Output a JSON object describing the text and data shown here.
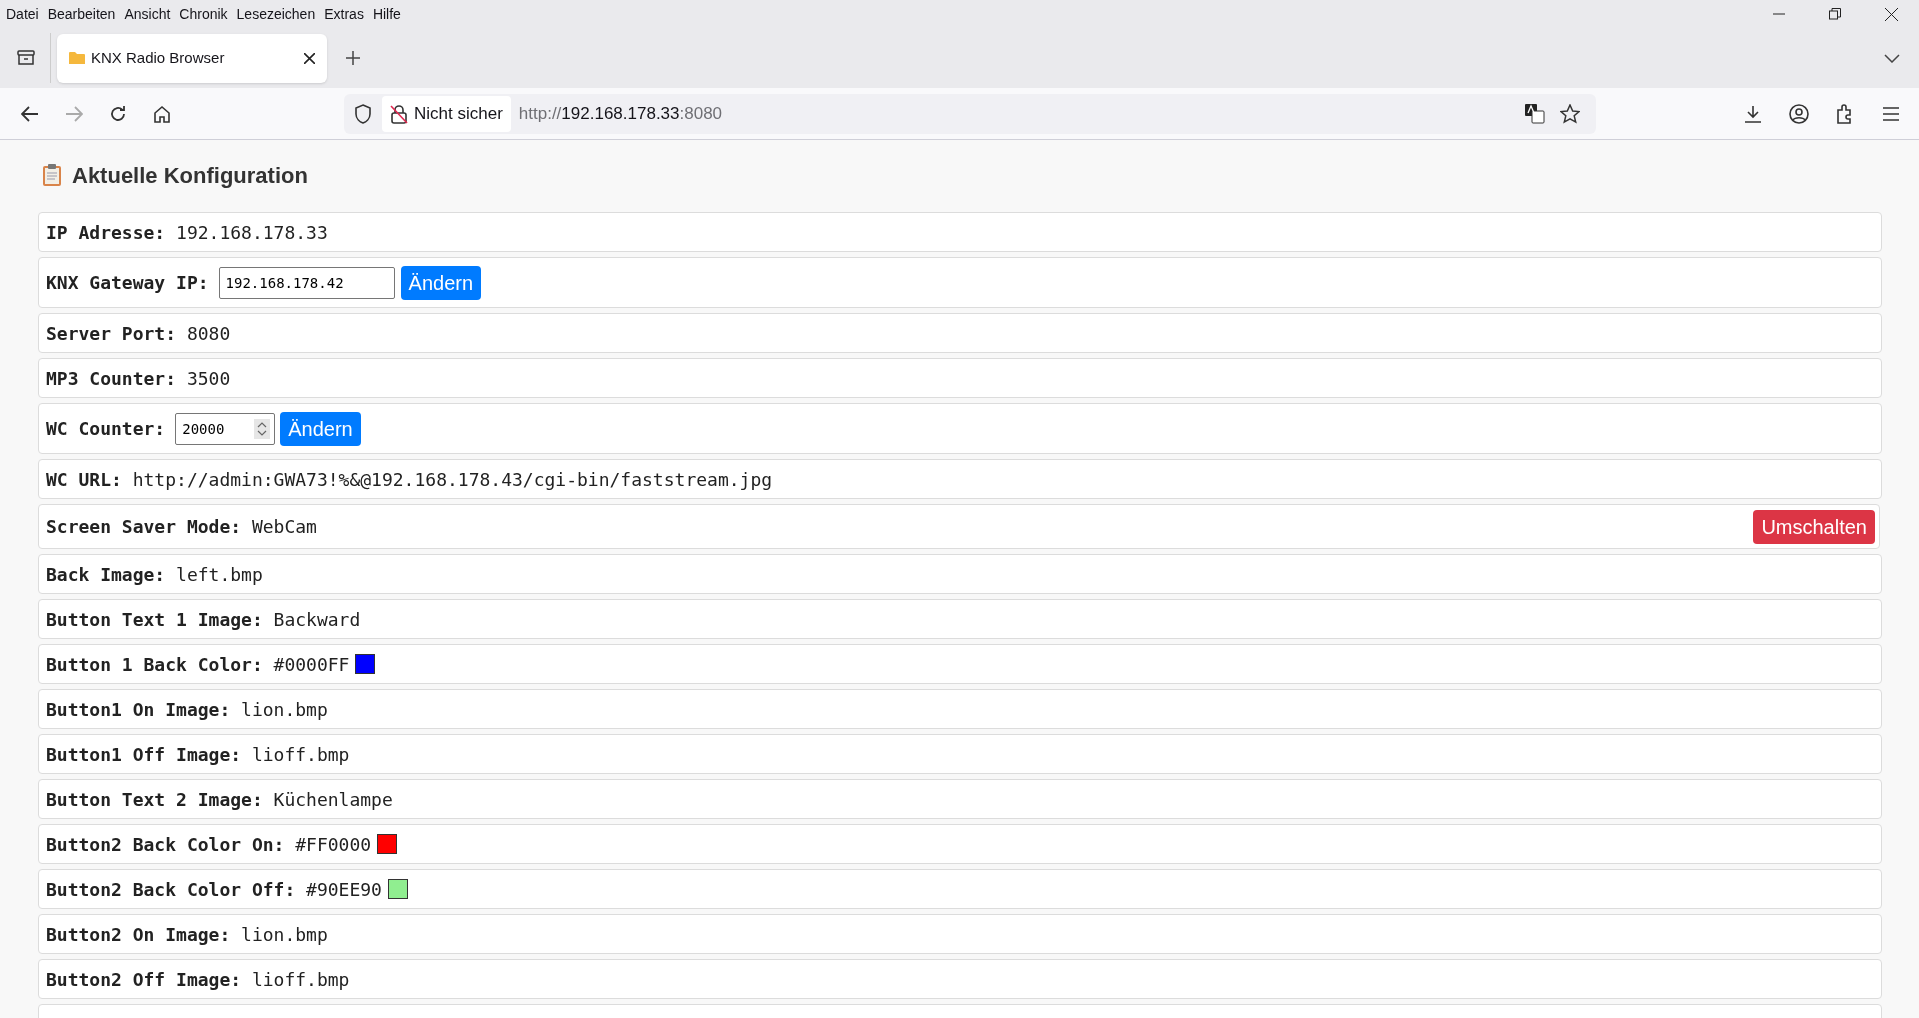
{
  "menu_bar": [
    "Datei",
    "Bearbeiten",
    "Ansicht",
    "Chronik",
    "Lesezeichen",
    "Extras",
    "Hilfe"
  ],
  "tab": {
    "title": "KNX Radio Browser",
    "selected": true
  },
  "address_bar": {
    "security": "Nicht sicher",
    "scheme": "http://",
    "host": "192.168.178.33",
    "port": ":8080"
  },
  "heading": "Aktuelle Konfiguration",
  "rows": [
    {
      "kind": "text",
      "label": "IP Adresse:",
      "value": "192.168.178.33"
    },
    {
      "kind": "input",
      "label": "KNX Gateway IP:",
      "value": "192.168.178.42",
      "button": "Ändern"
    },
    {
      "kind": "text",
      "label": "Server Port:",
      "value": "8080"
    },
    {
      "kind": "text",
      "label": "MP3 Counter:",
      "value": "3500"
    },
    {
      "kind": "number",
      "label": "WC Counter:",
      "value": "20000",
      "button": "Ändern"
    },
    {
      "kind": "text",
      "label": "WC URL:",
      "value": "http://admin:GWA73!%&@192.168.178.43/cgi-bin/faststream.jpg"
    },
    {
      "kind": "mode",
      "label": "Screen Saver Mode:",
      "value": "WebCam",
      "button": "Umschalten"
    },
    {
      "kind": "text",
      "label": "Back Image:",
      "value": "left.bmp"
    },
    {
      "kind": "text",
      "label": "Button Text 1 Image:",
      "value": "Backward"
    },
    {
      "kind": "color",
      "label": "Button 1 Back Color:",
      "value": "#0000FF",
      "color": "#0000ff"
    },
    {
      "kind": "text",
      "label": "Button1 On Image:",
      "value": "lion.bmp"
    },
    {
      "kind": "text",
      "label": "Button1 Off Image:",
      "value": "lioff.bmp"
    },
    {
      "kind": "text",
      "label": "Button Text 2 Image:",
      "value": "Küchenlampe"
    },
    {
      "kind": "color",
      "label": "Button2 Back Color On:",
      "value": "#FF0000",
      "color": "#ff0000"
    },
    {
      "kind": "color",
      "label": "Button2 Back Color Off:",
      "value": "#90EE90",
      "color": "#90ee90"
    },
    {
      "kind": "text",
      "label": "Button2 On Image:",
      "value": "lion.bmp"
    },
    {
      "kind": "text",
      "label": "Button2 Off Image:",
      "value": "lioff.bmp"
    },
    {
      "kind": "blank"
    }
  ]
}
